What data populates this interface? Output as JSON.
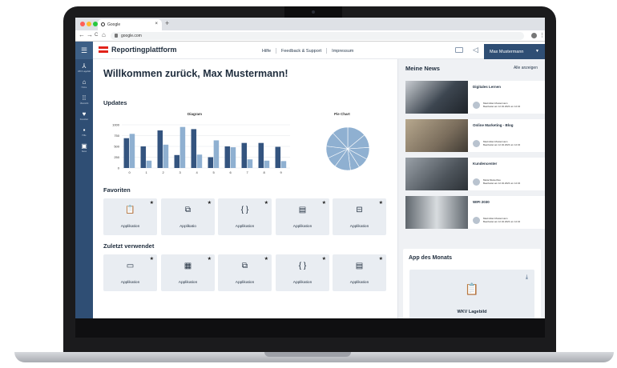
{
  "browser": {
    "tab_title": "Google",
    "tab_close": "×",
    "new_tab": "+",
    "url": "google.com",
    "nav_back": "←",
    "nav_forward": "→",
    "nav_reload": "C",
    "nav_home": "⌂",
    "menu": "⋮"
  },
  "header": {
    "menu_icon": "☰",
    "brand": "Reportingplattform",
    "links": [
      "Hilfe",
      "Feedback & Support",
      "Impressum"
    ],
    "user": "Max Mustermann",
    "user_caret": "▼",
    "brand_color": "#2f4e74",
    "logo_color": "#e2231a"
  },
  "sidebar": {
    "items": [
      {
        "icon": "⅄",
        "label": "WKV Lagebild",
        "icon_name": "tree-icon"
      },
      {
        "icon": "⌂",
        "label": "Home",
        "icon_name": "home-icon"
      },
      {
        "icon": "⁞⁞",
        "label": "Übersicht",
        "icon_name": "grid-icon"
      },
      {
        "icon": "♥",
        "label": "Favoriten",
        "icon_name": "heart-icon"
      },
      {
        "icon": "▪",
        "label": "Hilfe",
        "icon_name": "help-icon"
      },
      {
        "icon": "▣",
        "label": "News",
        "icon_name": "news-icon"
      }
    ]
  },
  "main": {
    "welcome": "Willkommen zurück, Max Mustermann!",
    "updates_title": "Updates",
    "favorites_title": "Favoriten",
    "recent_title": "Zuletzt verwendet",
    "star": "★",
    "favorites": [
      {
        "icon": "📋",
        "label": "Applikation"
      },
      {
        "icon": "⧉",
        "label": "Applikatio"
      },
      {
        "icon": "{ }",
        "label": "Applikation"
      },
      {
        "icon": "▤",
        "label": "Applikation"
      },
      {
        "icon": "⊟",
        "label": "Applikation"
      }
    ],
    "recent": [
      {
        "icon": "▭",
        "label": "Applikation"
      },
      {
        "icon": "▦",
        "label": "Applikation"
      },
      {
        "icon": "⧉",
        "label": "Applikation"
      },
      {
        "icon": "{ }",
        "label": "Applikation"
      },
      {
        "icon": "▤",
        "label": "Applikation"
      }
    ]
  },
  "news": {
    "title": "Meine News",
    "all_link": "Alle anzeigen",
    "items": [
      {
        "title": "Digitales Lernen",
        "author": "Maximilian Mustermann",
        "edited": "Bearbeitet am 12.04.2023 um 12:34",
        "img_color": "#4b5560"
      },
      {
        "title": "Online Marketing - Blog",
        "author": "Maximilian Mustermann",
        "edited": "Bearbeitet am 12.04.2023 um 12:34",
        "img_color": "#8b7d6a"
      },
      {
        "title": "Kundencenter",
        "author": "Maria Musterfrau",
        "edited": "Bearbeitet am 12.04.2023 um 12:34",
        "img_color": "#6f757c"
      },
      {
        "title": "WIFI 2030",
        "author": "Maximilian Mustermann",
        "edited": "Bearbeitet am 12.04.2023 um 12:34",
        "img_color": "#9aa0a6"
      }
    ]
  },
  "app_of_month": {
    "title": "App des Monats",
    "label": "WKV Lagebild",
    "icon": "📋",
    "download_icon": "⤓"
  },
  "chart_data": [
    {
      "type": "bar",
      "title": "Diagram",
      "categories": [
        "0",
        "1",
        "2",
        "3",
        "4",
        "5",
        "6",
        "7",
        "8",
        "9"
      ],
      "ylim": [
        0,
        1000
      ],
      "yticks": [
        "0",
        "250",
        "500",
        "750",
        "1000"
      ],
      "series": [
        {
          "color": "#34547f",
          "values": [
            690,
            500,
            870,
            300,
            900,
            250,
            500,
            580,
            580,
            490
          ]
        },
        {
          "color": "#8fb0d1",
          "values": [
            790,
            170,
            540,
            950,
            310,
            640,
            480,
            200,
            170,
            160
          ]
        }
      ]
    },
    {
      "type": "pie",
      "title": "Pie Chart",
      "values": [
        14,
        10,
        9,
        8,
        7,
        12,
        8,
        9,
        11,
        12
      ],
      "colors": [
        "#8fb0d1"
      ]
    }
  ]
}
